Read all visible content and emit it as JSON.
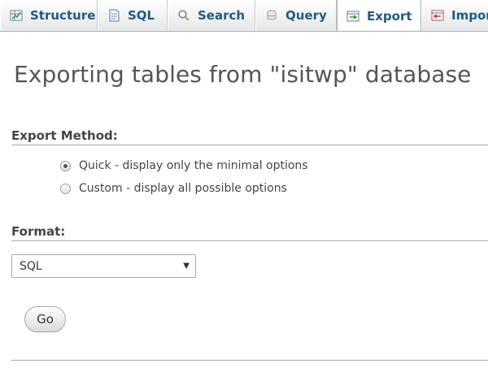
{
  "tabs": [
    {
      "label": "Structure",
      "icon": "structure-icon",
      "active": false
    },
    {
      "label": "SQL",
      "icon": "sql-icon",
      "active": false
    },
    {
      "label": "Search",
      "icon": "search-icon",
      "active": false
    },
    {
      "label": "Query",
      "icon": "query-icon",
      "active": false
    },
    {
      "label": "Export",
      "icon": "export-icon",
      "active": true
    },
    {
      "label": "Import",
      "icon": "import-icon",
      "active": false
    }
  ],
  "page": {
    "title": "Exporting tables from \"isitwp\" database"
  },
  "export_method": {
    "heading": "Export Method:",
    "options": [
      {
        "label": "Quick - display only the minimal options",
        "checked": true
      },
      {
        "label": "Custom - display all possible options",
        "checked": false
      }
    ]
  },
  "format": {
    "heading": "Format:",
    "selected": "SQL"
  },
  "actions": {
    "go_label": "Go"
  },
  "colors": {
    "tab_text": "#235a81",
    "heading_text": "#444444",
    "title_text": "#555555",
    "rule": "#aaaaaa"
  }
}
